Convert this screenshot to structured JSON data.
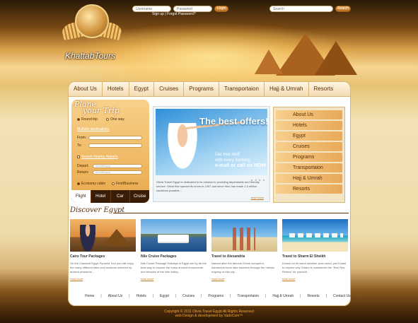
{
  "header": {
    "username_placeholder": "Username",
    "password_placeholder": "Password",
    "login_label": "Login",
    "signup_label": "Sign up",
    "forgot_label": "Forgot Password?",
    "search_placeholder": "Search",
    "search_button": "Search",
    "logo_text": "KhattabTours"
  },
  "nav": [
    "About Us",
    "Hotels",
    "Egypt",
    "Cruises",
    "Programs",
    "Transportaion",
    "Hajj & Umrah",
    "Resorts"
  ],
  "booking": {
    "title_line1": "Plane",
    "title_line2": "your Trip",
    "round_trip": "Round trip",
    "one_way": "One way",
    "multiple": "Multiple destinations",
    "from_label": "From:",
    "to_label": "To:",
    "nearby": "Search Nearby Airports",
    "depart_label": "Depart:",
    "return_label": "Return:",
    "date_placeholder": "mm/dd/yyyy",
    "economy": "Economy cabin",
    "first": "First/Business",
    "tabs": [
      "Flight",
      "Hotel",
      "Car",
      "Cruise"
    ]
  },
  "offer": {
    "headline": "The best offers!",
    "sub1": "Get free stuff",
    "sub2": "with every booking",
    "sub3": "e-mail or call us NOW",
    "text": "Olivia Travel Egypt is dedicated to its mission to providing dependable and friendly service. Olivia first opened its doors in 1997 and since then has made 1.5 million vacations possible...",
    "more": "read more"
  },
  "sidemenu": [
    "About Us",
    "Hotels",
    "Egypt",
    "Cruises",
    "Programs",
    "Transportaion",
    "Hajj & Umrah",
    "Resorts"
  ],
  "discover": {
    "title": "Discover Egypt",
    "cards": [
      {
        "title": "Cairo Tour Packages",
        "text": "On the Classical Egypt Pyramid Tour you will enjoy the many different sites and locations selected by ancient pharaohs...",
        "more": "read more"
      },
      {
        "title": "Nile Cruise Packages",
        "text": "Nile Cruise Package Holidays in Egypt are by far the best way to explore the many ancient monuments and temples of the Nile Valley...",
        "more": "read more"
      },
      {
        "title": "Travel to Alexandria",
        "text": "Named after the famous Greek conqueror, Alexandria tours take travelers through the historic majesty of this city...",
        "more": "read more"
      },
      {
        "title": "Travel to Sharm El Sheikh",
        "text": "Known for its warm weather year round, you'll want to explore why Sharm is considered the \"Red Sea Riviera\" for yourself...",
        "more": "read more"
      }
    ]
  },
  "footer": {
    "links": [
      "Home",
      "About Us",
      "Hotels",
      "Egypt",
      "Cruises",
      "Programs",
      "Transportaion",
      "Hajj & Umrah",
      "Resorts",
      "Contact Us"
    ],
    "copyright": "Copyright © 2011 Olivia Travel Egypt All Rights Reserved",
    "credit": "web Design & development by VadoCom™"
  }
}
